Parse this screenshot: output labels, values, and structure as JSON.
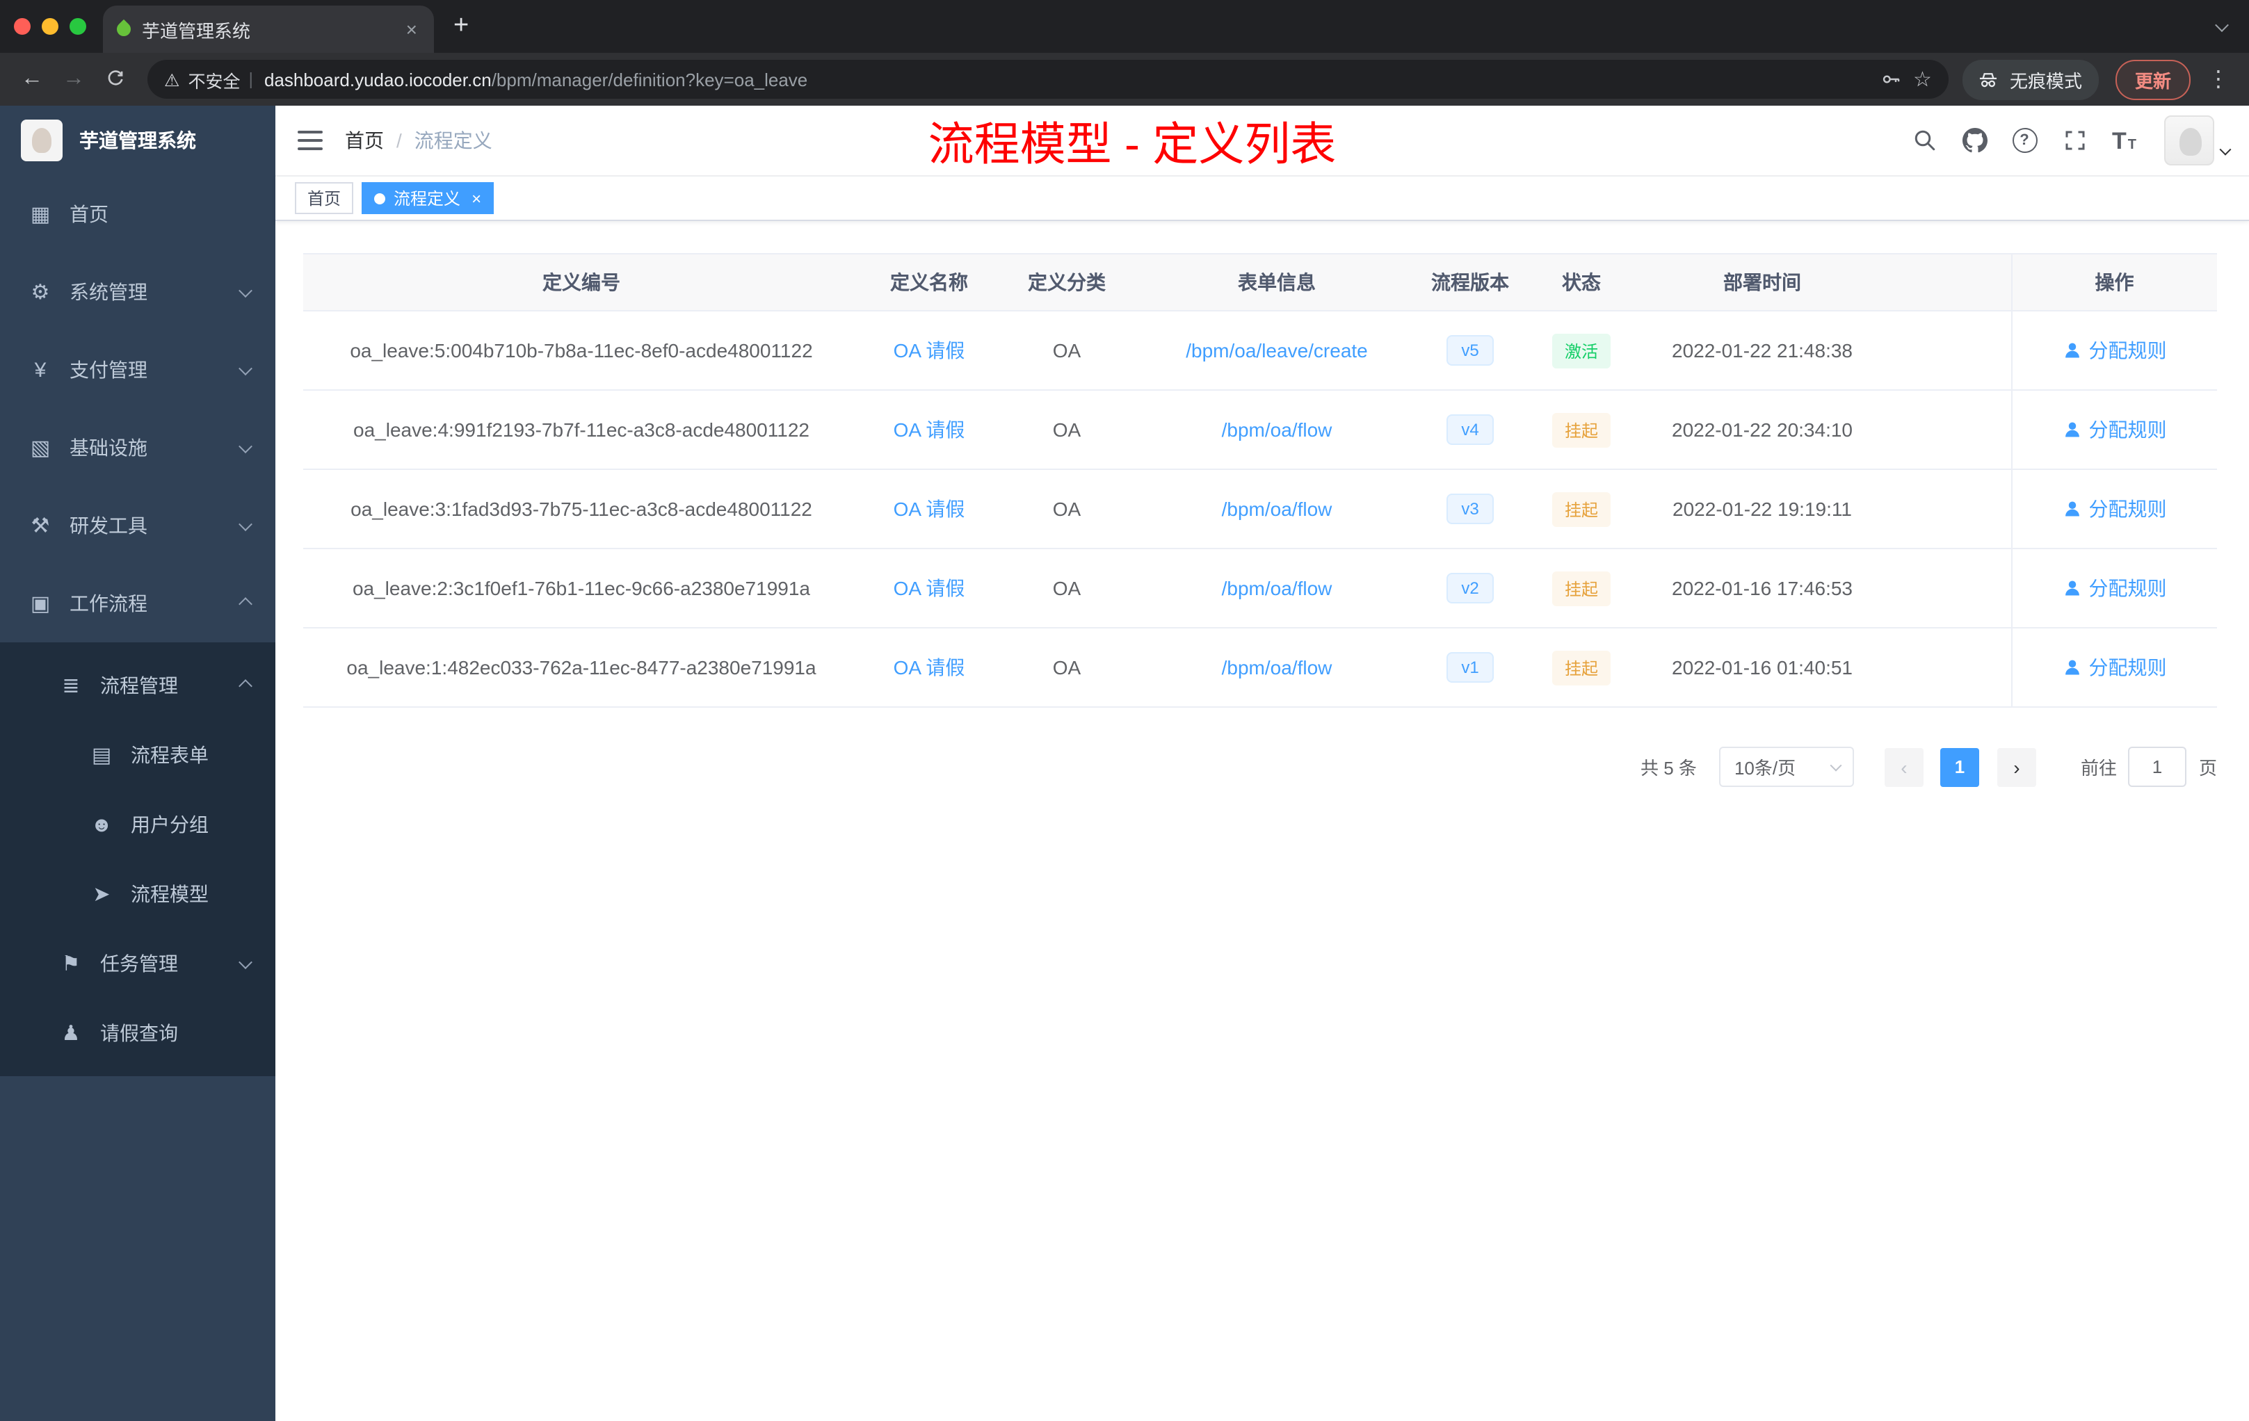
{
  "browser": {
    "tab_title": "芋道管理系统",
    "tab_close": "×",
    "new_tab": "+",
    "back": "←",
    "forward": "→",
    "warning_icon": "⚠",
    "security_label": "不安全",
    "url_divider": "|",
    "url_domain": "dashboard.yudao.iocoder.cn",
    "url_path": "/bpm/manager/definition?key=oa_leave",
    "star_icon": "☆",
    "incognito_label": "无痕模式",
    "update_label": "更新",
    "menu_icon": "⋮"
  },
  "icons": {
    "dashboard": "▦",
    "gear": "⚙",
    "yen": "¥",
    "infra": "▧",
    "tools": "⚒",
    "workflow": "▣",
    "list": "≣",
    "form": "▤",
    "group": "☻",
    "send": "➤",
    "task": "⚑",
    "user": "♟",
    "question": "?"
  },
  "sidebar": {
    "logo_title": "芋道管理系统",
    "items": [
      {
        "label": "首页"
      },
      {
        "label": "系统管理"
      },
      {
        "label": "支付管理"
      },
      {
        "label": "基础设施"
      },
      {
        "label": "研发工具"
      },
      {
        "label": "工作流程"
      },
      {
        "label": "流程管理"
      },
      {
        "label": "流程表单"
      },
      {
        "label": "用户分组"
      },
      {
        "label": "流程模型"
      },
      {
        "label": "任务管理"
      },
      {
        "label": "请假查询"
      }
    ]
  },
  "header": {
    "breadcrumb_home": "首页",
    "breadcrumb_sep": "/",
    "breadcrumb_current": "流程定义",
    "annotation": "流程模型 - 定义列表"
  },
  "tags": {
    "home": "首页",
    "current": "流程定义",
    "close_icon": "×"
  },
  "table": {
    "columns": [
      "定义编号",
      "定义名称",
      "定义分类",
      "表单信息",
      "流程版本",
      "状态",
      "部署时间",
      "操作"
    ],
    "action_label": "分配规则",
    "rows": [
      {
        "id": "oa_leave:5:004b710b-7b8a-11ec-8ef0-acde48001122",
        "name": "OA 请假",
        "category": "OA",
        "form": "/bpm/oa/leave/create",
        "version": "v5",
        "status": "激活",
        "time": "2022-01-22 21:48:38"
      },
      {
        "id": "oa_leave:4:991f2193-7b7f-11ec-a3c8-acde48001122",
        "name": "OA 请假",
        "category": "OA",
        "form": "/bpm/oa/flow",
        "version": "v4",
        "status": "挂起",
        "time": "2022-01-22 20:34:10"
      },
      {
        "id": "oa_leave:3:1fad3d93-7b75-11ec-a3c8-acde48001122",
        "name": "OA 请假",
        "category": "OA",
        "form": "/bpm/oa/flow",
        "version": "v3",
        "status": "挂起",
        "time": "2022-01-22 19:19:11"
      },
      {
        "id": "oa_leave:2:3c1f0ef1-76b1-11ec-9c66-a2380e71991a",
        "name": "OA 请假",
        "category": "OA",
        "form": "/bpm/oa/flow",
        "version": "v2",
        "status": "挂起",
        "time": "2022-01-16 17:46:53"
      },
      {
        "id": "oa_leave:1:482ec033-762a-11ec-8477-a2380e71991a",
        "name": "OA 请假",
        "category": "OA",
        "form": "/bpm/oa/flow",
        "version": "v1",
        "status": "挂起",
        "time": "2022-01-16 01:40:51"
      }
    ]
  },
  "pagination": {
    "total": "共 5 条",
    "page_size": "10条/页",
    "prev_icon": "‹",
    "next_icon": "›",
    "current": "1",
    "goto": "前往",
    "goto_value": "1",
    "unit": "页"
  },
  "colors": {
    "primary": "#409eff",
    "success": "#13ce66",
    "warning": "#e6a23c",
    "annotation": "#fe0000",
    "sidebar_bg": "#304156",
    "submenu_bg": "#1f2d3d"
  }
}
